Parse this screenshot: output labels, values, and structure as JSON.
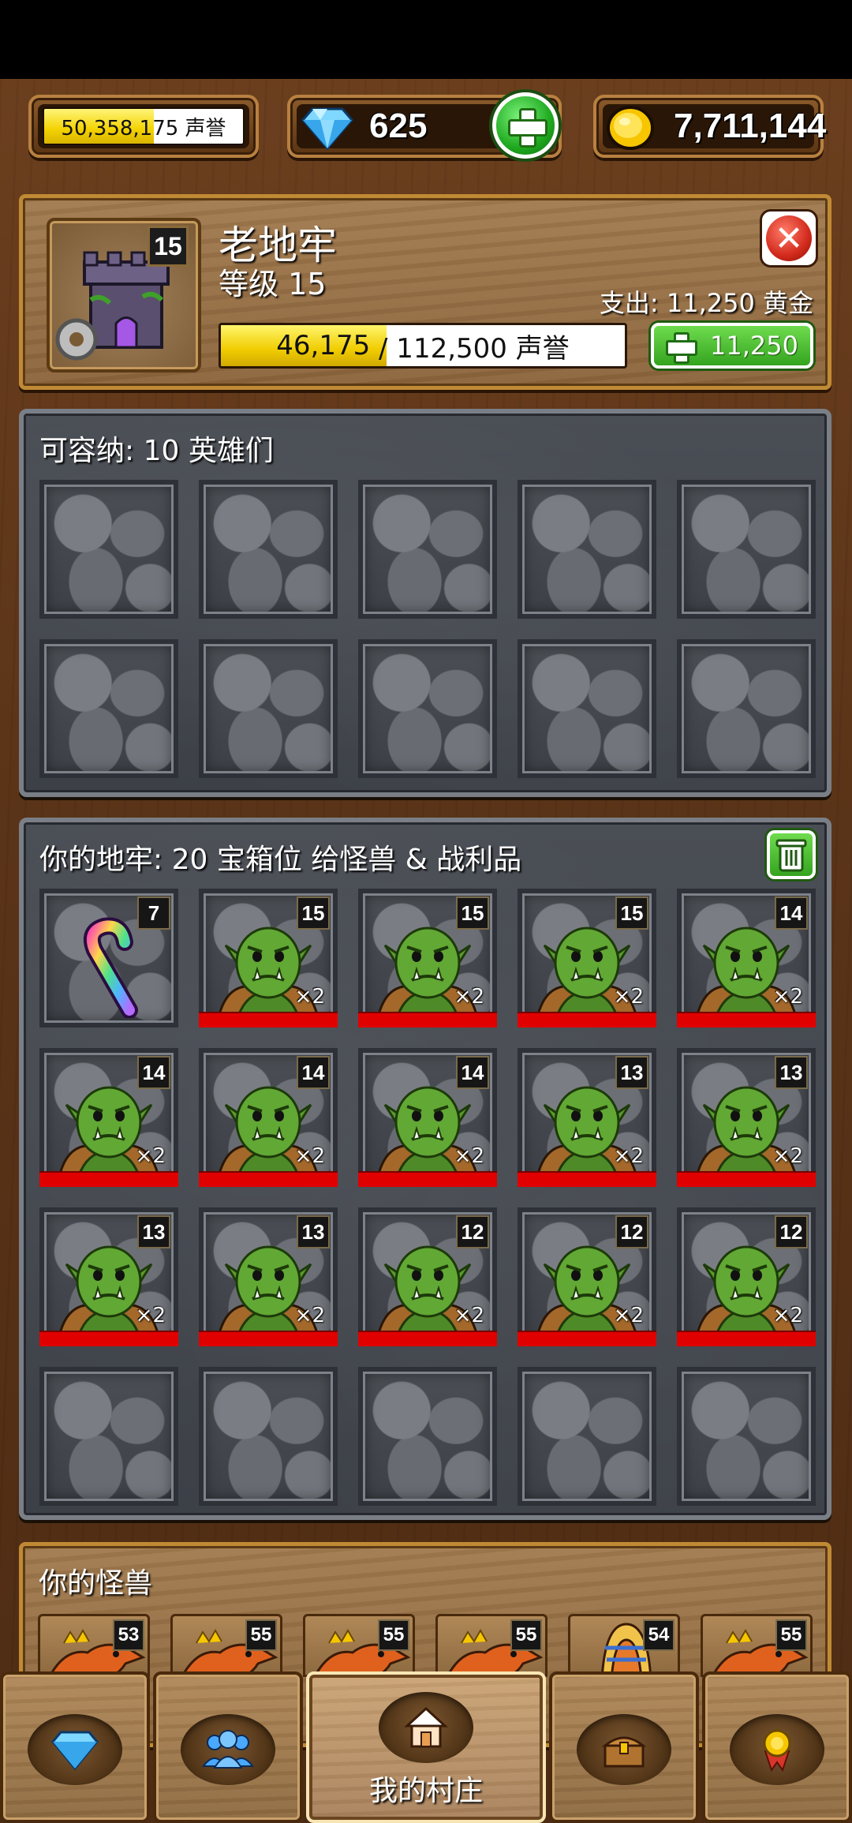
{
  "resources": {
    "reputation": "50,358,175 声誉",
    "reputation_fill": 0.55,
    "gems": "625",
    "gold": "7,711,144"
  },
  "building": {
    "name": "老地牢",
    "level_badge": "15",
    "level_text": "等级 15",
    "expense": "支出: 11,250 黄金",
    "progress_current": "46,175",
    "progress_rest": "/ 112,500 声誉",
    "progress_fill": 0.41,
    "upgrade_cost": "11,250"
  },
  "heroes": {
    "title": "可容纳: 10 英雄们",
    "slots": 10
  },
  "dungeon": {
    "title": "你的地牢: 20 宝箱位 给怪兽 & 战利品",
    "items": [
      {
        "type": "candy",
        "level": "7"
      },
      {
        "type": "orc",
        "level": "15",
        "count": "×2"
      },
      {
        "type": "orc",
        "level": "15",
        "count": "×2"
      },
      {
        "type": "orc",
        "level": "15",
        "count": "×2"
      },
      {
        "type": "orc",
        "level": "14",
        "count": "×2"
      },
      {
        "type": "orc",
        "level": "14",
        "count": "×2"
      },
      {
        "type": "orc",
        "level": "14",
        "count": "×2"
      },
      {
        "type": "orc",
        "level": "14",
        "count": "×2"
      },
      {
        "type": "orc",
        "level": "13",
        "count": "×2"
      },
      {
        "type": "orc",
        "level": "13",
        "count": "×2"
      },
      {
        "type": "orc",
        "level": "13",
        "count": "×2"
      },
      {
        "type": "orc",
        "level": "13",
        "count": "×2"
      },
      {
        "type": "orc",
        "level": "12",
        "count": "×2"
      },
      {
        "type": "orc",
        "level": "12",
        "count": "×2"
      },
      {
        "type": "orc",
        "level": "12",
        "count": "×2"
      },
      {
        "type": "empty"
      },
      {
        "type": "empty"
      },
      {
        "type": "empty"
      },
      {
        "type": "empty"
      },
      {
        "type": "empty"
      }
    ]
  },
  "monsters": {
    "title": "你的怪兽",
    "levels": [
      "53",
      "55",
      "55",
      "55",
      "54",
      "55"
    ]
  },
  "nav": {
    "items": [
      {
        "icon": "diamond-icon"
      },
      {
        "icon": "people-icon"
      },
      {
        "icon": "house-icon",
        "label": "我的村庄",
        "active": true
      },
      {
        "icon": "chest-icon"
      },
      {
        "icon": "medal-icon"
      }
    ]
  },
  "colors": {
    "wood": "#6b3f1e",
    "gold_trim": "#c08a35",
    "stone": "#4a4e55",
    "green": "#34a31f",
    "red": "#e00000",
    "orc": "#5a8d2a"
  }
}
